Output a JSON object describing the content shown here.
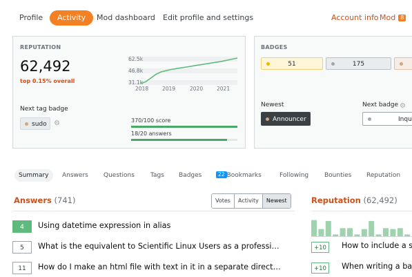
{
  "nav": {
    "tabs": [
      "Profile",
      "Activity",
      "Mod dashboard",
      "Edit profile and settings"
    ],
    "account_info": "Account info",
    "mod_label": "Mod",
    "mod_count": "8"
  },
  "reputation": {
    "title": "REPUTATION",
    "value": "62,492",
    "rank": "top 0.15% overall",
    "next_tag_badge_label": "Next tag badge",
    "next_tag": "sudo",
    "chart_data": {
      "type": "line",
      "x": [
        2017.8,
        2018,
        2018.2,
        2018.4,
        2018.6,
        2018.8,
        2019,
        2019.3,
        2019.6,
        2020,
        2020.3,
        2020.6,
        2021,
        2021.3,
        2021.6
      ],
      "y": [
        31.1,
        33.5,
        38.0,
        42.5,
        45.5,
        47.0,
        48.5,
        50.0,
        51.5,
        53.5,
        55.0,
        56.5,
        58.5,
        60.5,
        62.5
      ],
      "ytick_labels": [
        "62.5k",
        "46.8k",
        "31.1k"
      ],
      "xtick_labels": [
        "2018",
        "2019",
        "2020",
        "2021"
      ],
      "ylim": [
        31.1,
        62.5
      ],
      "line_color": "#5eba7d"
    },
    "progress": [
      {
        "label": "370/100 score",
        "fraction": 1.0
      },
      {
        "label": "18/20 answers",
        "fraction": 0.9
      }
    ]
  },
  "badges": {
    "title": "BADGES",
    "counts": [
      {
        "count": "51",
        "kind": "gold",
        "color": "#f1b600"
      },
      {
        "count": "175",
        "kind": "silver",
        "color": "#9fa6ad"
      },
      {
        "count": "",
        "kind": "bronze",
        "color": "#d1a684"
      }
    ],
    "newest_label": "Newest",
    "newest_badge": "Announcer",
    "next_badge_label": "Next badge",
    "next_badge": "Inqu"
  },
  "subtabs": [
    {
      "label": "Summary"
    },
    {
      "label": "Answers"
    },
    {
      "label": "Questions"
    },
    {
      "label": "Tags"
    },
    {
      "label": "Badges"
    },
    {
      "label": "Bookmarks",
      "count": "22"
    },
    {
      "label": "Following"
    },
    {
      "label": "Bounties"
    },
    {
      "label": "Reputation"
    }
  ],
  "answers": {
    "title": "Answers",
    "count": "(741)",
    "filters": [
      "Votes",
      "Activity",
      "Newest"
    ],
    "rows": [
      {
        "score": "4",
        "accepted": true,
        "title": "Using datetime expression in alias"
      },
      {
        "score": "5",
        "accepted": false,
        "title": "What is the equivalent to Scientific Linux Users as a professi…"
      },
      {
        "score": "11",
        "accepted": false,
        "title": "How do I make an html file with text in it in a separate direct…"
      }
    ]
  },
  "rep_panel": {
    "title": "Reputation",
    "count": "(62,492)",
    "sparkline": [
      0.9,
      0.4,
      0.85,
      0.1,
      0.45,
      0.45,
      0.1,
      0.4,
      0.85,
      0.1,
      0.45,
      0.4,
      0.45,
      0.1
    ],
    "rows": [
      {
        "score": "+10",
        "title": "How to include a sp"
      },
      {
        "score": "+10",
        "title": "When writing a bas"
      }
    ]
  }
}
